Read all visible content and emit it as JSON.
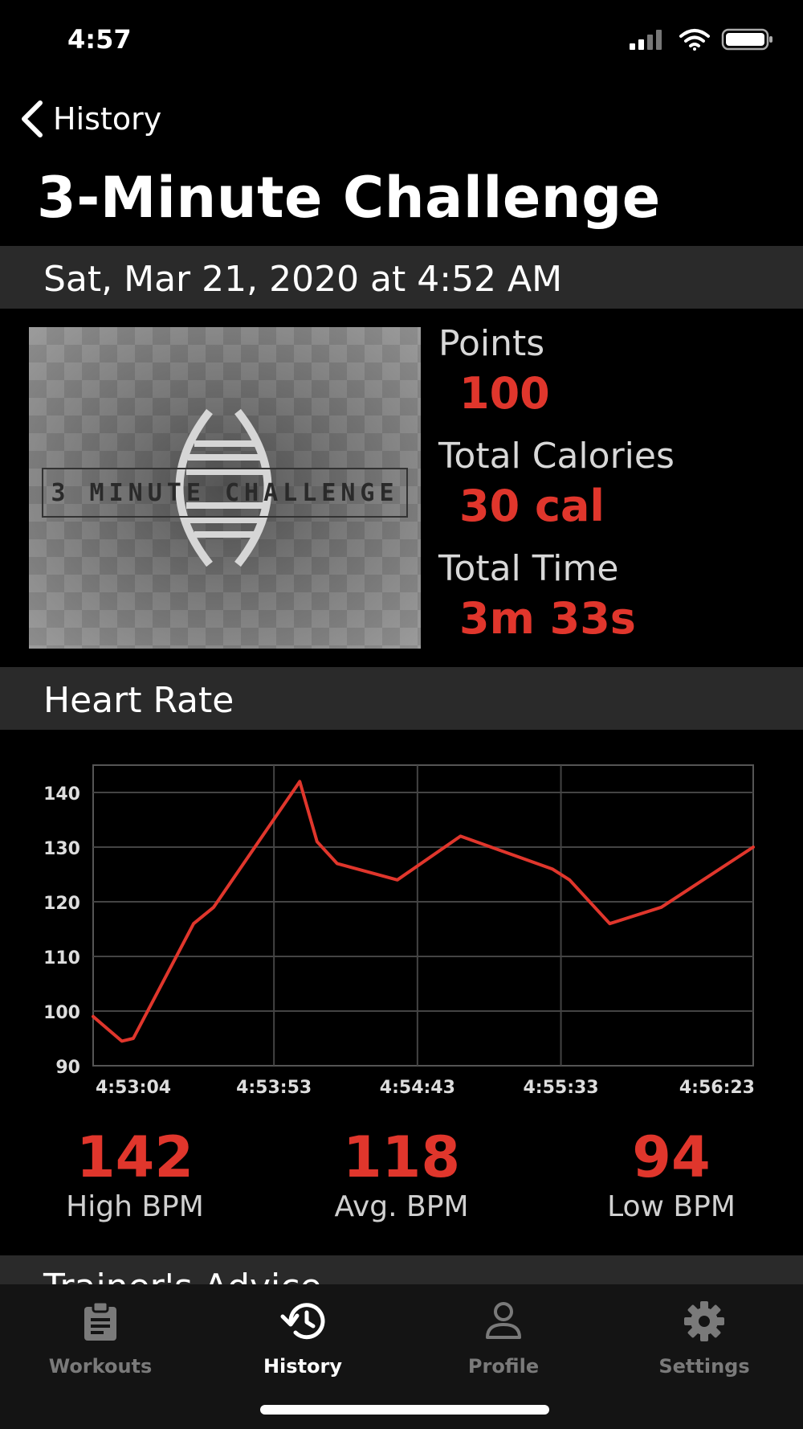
{
  "status_bar": {
    "time": "4:57"
  },
  "nav": {
    "back_label": "History"
  },
  "page_title": "3-Minute Challenge",
  "session_date": "Sat, Mar 21, 2020 at 4:52 AM",
  "thumbnail": {
    "caption": "3 MINUTE CHALLENGE"
  },
  "stats": [
    {
      "label": "Points",
      "value": "100"
    },
    {
      "label": "Total Calories",
      "value": "30 cal"
    },
    {
      "label": "Total Time",
      "value": "3m 33s"
    }
  ],
  "heart_rate_section": {
    "title": "Heart Rate"
  },
  "chart_data": {
    "type": "line",
    "title": "",
    "xlabel": "",
    "ylabel": "",
    "ylim": [
      90,
      145
    ],
    "y_ticks": [
      90,
      100,
      110,
      120,
      130,
      140
    ],
    "x_tick_labels": [
      "4:53:04",
      "4:53:53",
      "4:54:43",
      "4:55:33",
      "4:56:23"
    ],
    "grid": true,
    "series": [
      {
        "color": "#e0362c",
        "x": [
          "4:52:50",
          "4:53:00",
          "4:53:04",
          "4:53:25",
          "4:53:32",
          "4:54:02",
          "4:54:08",
          "4:54:15",
          "4:54:36",
          "4:54:58",
          "4:55:30",
          "4:55:36",
          "4:55:50",
          "4:56:08",
          "4:56:40"
        ],
        "values": [
          99,
          94.5,
          95,
          116,
          119,
          142,
          131,
          127,
          124,
          132,
          126,
          124,
          116,
          119,
          130
        ]
      }
    ]
  },
  "bpm_summary": [
    {
      "value": "142",
      "label": "High BPM"
    },
    {
      "value": "118",
      "label": "Avg. BPM"
    },
    {
      "value": "94",
      "label": "Low BPM"
    }
  ],
  "advice_section": {
    "title": "Trainer's Advice"
  },
  "tab_bar": [
    {
      "label": "Workouts",
      "icon": "clipboard-icon",
      "active": false
    },
    {
      "label": "History",
      "icon": "history-icon",
      "active": true
    },
    {
      "label": "Profile",
      "icon": "person-icon",
      "active": false
    },
    {
      "label": "Settings",
      "icon": "gear-icon",
      "active": false
    }
  ],
  "colors": {
    "accent": "#e0362c",
    "background": "#000000",
    "band": "#2a2a2a"
  }
}
